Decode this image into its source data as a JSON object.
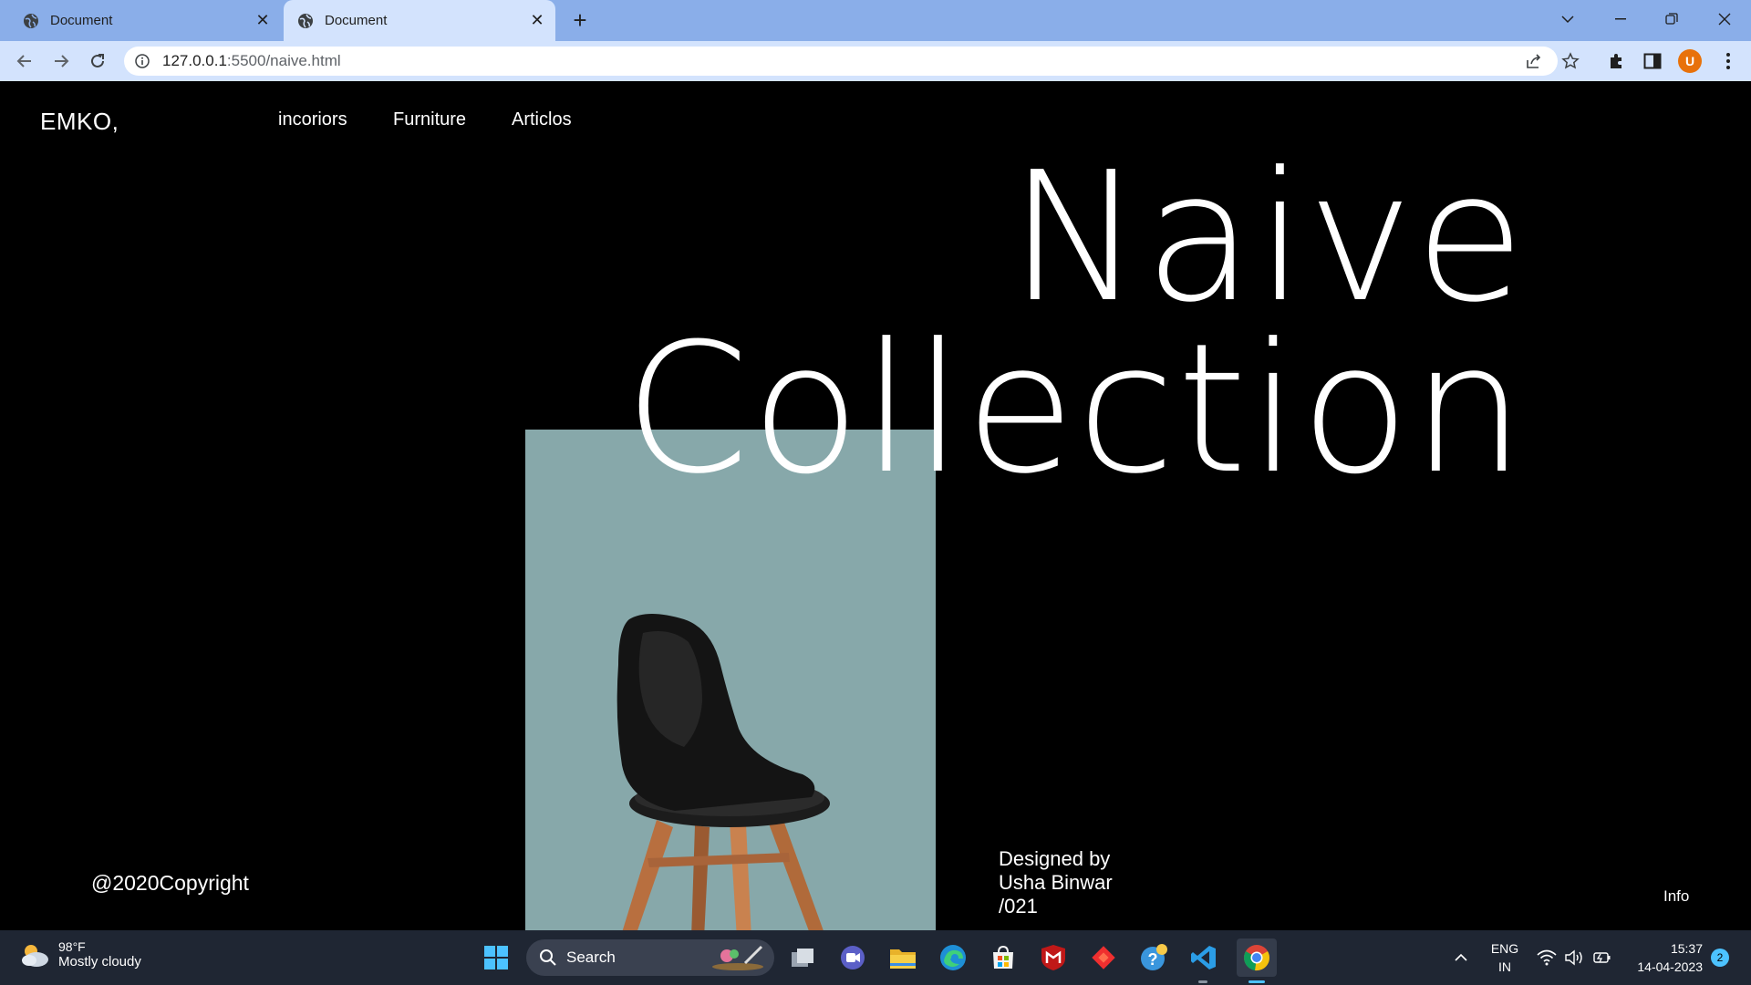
{
  "browser": {
    "tabs": [
      {
        "title": "Document"
      },
      {
        "title": "Document"
      }
    ],
    "url_host": "127.0.0.1",
    "url_path": ":5500/naive.html",
    "profile_initial": "U"
  },
  "page": {
    "brand": "EMKO,",
    "nav": [
      "incoriors",
      "Furniture",
      "Articlos"
    ],
    "hero_line1": "Naive",
    "hero_line2": "Collection",
    "copyright": "@2020Copyright",
    "credits": [
      "Designed by",
      "Usha Binwar",
      "/021"
    ],
    "info": "Info",
    "panel_color": "#87a8aa"
  },
  "taskbar": {
    "weather_temp": "98°F",
    "weather_cond": "Mostly cloudy",
    "search_label": "Search",
    "lang": "ENG",
    "region": "IN",
    "time": "15:37",
    "date": "14-04-2023",
    "notifications": "2"
  }
}
